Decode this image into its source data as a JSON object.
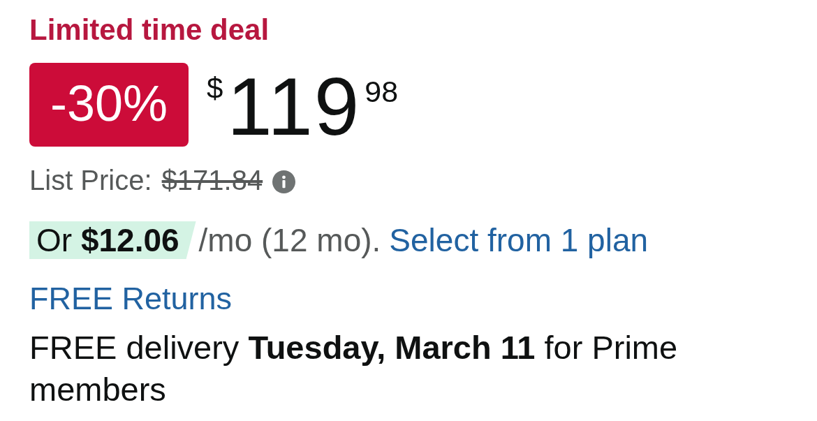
{
  "deal_label": "Limited time deal",
  "discount_badge": "-30%",
  "price": {
    "currency": "$",
    "whole": "119",
    "fraction": "98"
  },
  "list_price": {
    "label": "List Price:",
    "value": "$171.84"
  },
  "installment": {
    "offer": "Or **$12.06**",
    "terms": "/mo (12 mo).",
    "link": "Select from 1 plan"
  },
  "returns_link": "FREE Returns",
  "delivery": "FREE delivery **Tuesday, March 11** for Prime members"
}
